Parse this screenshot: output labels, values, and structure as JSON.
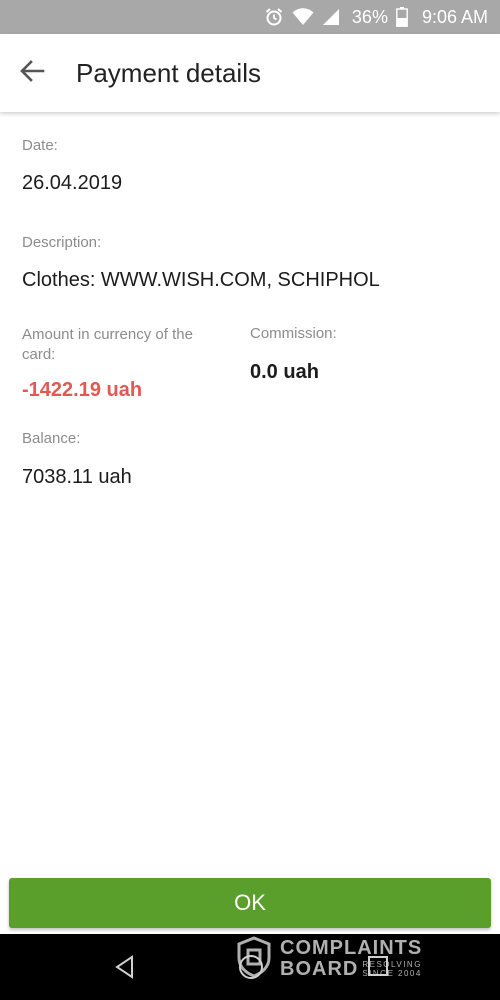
{
  "status_bar": {
    "alarm_icon": "alarm-clock-icon",
    "wifi_icon": "wifi-icon",
    "signal_icon": "cell-signal-icon",
    "battery_percent": "36%",
    "battery_icon": "battery-icon",
    "time": "9:06 AM"
  },
  "app_bar": {
    "back_icon": "arrow-left-icon",
    "title": "Payment details"
  },
  "details": {
    "date_label": "Date:",
    "date_value": "26.04.2019",
    "description_label": "Description:",
    "description_value": "Clothes: WWW.WISH.COM, SCHIPHOL",
    "amount_label": "Amount in currency of the card:",
    "amount_value": "-1422.19 uah",
    "commission_label": "Commission:",
    "commission_value": "0.0 uah",
    "balance_label": "Balance:",
    "balance_value": "7038.11 uah"
  },
  "ok_button": {
    "label": "OK"
  },
  "watermark": {
    "line1": "COMPLAINTS",
    "line2": "BOARD",
    "tag1": "RESOLVING",
    "tag2": "SINCE 2004"
  },
  "colors": {
    "status_bar": "#a8a8a8",
    "amount_negative": "#e05a53",
    "ok_button": "#5a9e2b",
    "label_gray": "#8c8c8c"
  }
}
